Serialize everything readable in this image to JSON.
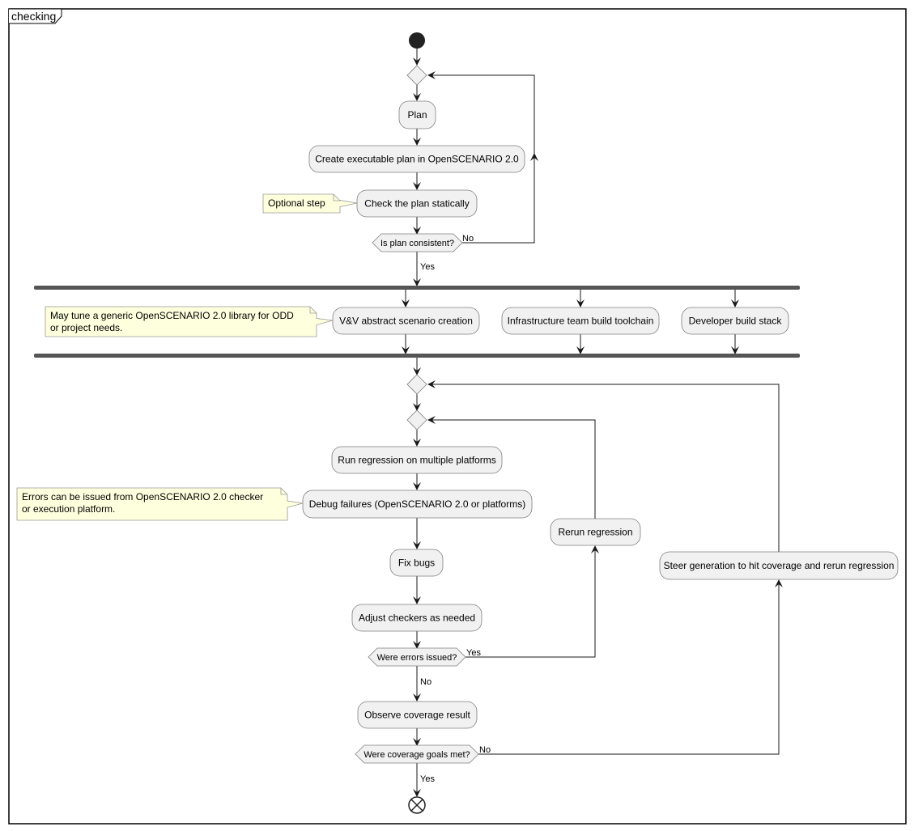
{
  "diagram": {
    "frame_title": "checking",
    "type": "activity",
    "colors": {
      "activity_fill": "#F1F1F1",
      "activity_border": "#7F7F7F",
      "note_fill": "#FEFFDD",
      "note_border": "#999999",
      "line": "#181818",
      "fork_bar": "#555555"
    },
    "activities": {
      "plan": "Plan",
      "create_plan": "Create executable plan in OpenSCENARIO 2.0",
      "check_plan": "Check the plan statically",
      "vv_scenario": "V&V abstract scenario creation",
      "infra_toolchain": "Infrastructure team build toolchain",
      "developer_stack": "Developer build stack",
      "run_regression": "Run regression on multiple platforms",
      "debug_failures": "Debug failures (OpenSCENARIO 2.0 or platforms)",
      "fix_bugs": "Fix bugs",
      "adjust_checkers": "Adjust checkers as needed",
      "rerun_regression": "Rerun regression",
      "observe_coverage": "Observe coverage result",
      "steer_generation": "Steer generation to hit coverage and rerun regression"
    },
    "decisions": {
      "plan_consistent": "Is plan consistent?",
      "errors_issued": "Were errors issued?",
      "coverage_met": "Were coverage goals met?"
    },
    "edge_labels": {
      "plan_no": "No",
      "plan_yes": "Yes",
      "errors_yes": "Yes",
      "errors_no": "No",
      "coverage_no": "No",
      "coverage_yes": "Yes"
    },
    "notes": {
      "optional_step": [
        "Optional step"
      ],
      "tune_library": [
        "May tune a generic OpenSCENARIO 2.0 library for ODD",
        "or project needs."
      ],
      "errors_source": [
        "Errors can be issued from OpenSCENARIO 2.0 checker",
        "or execution platform."
      ]
    }
  }
}
